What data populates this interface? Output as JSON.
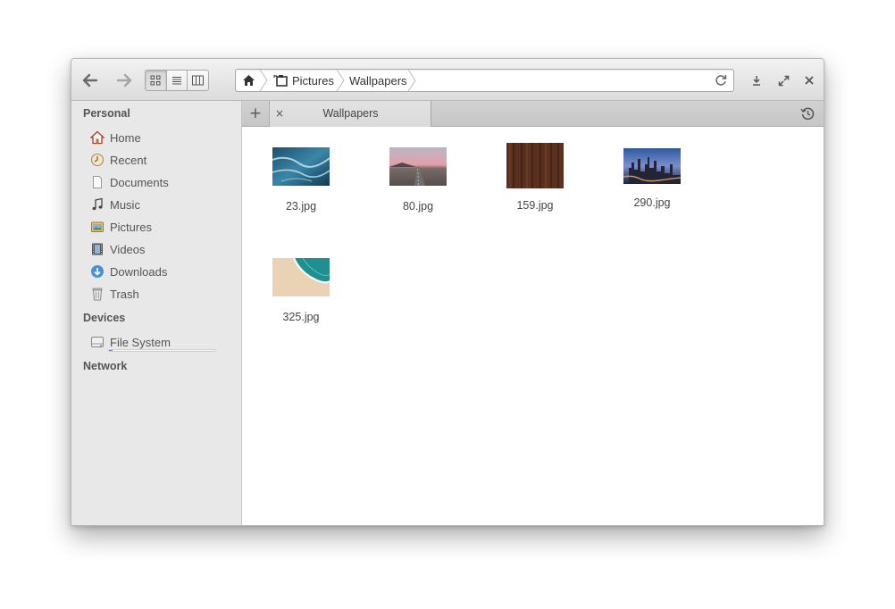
{
  "breadcrumbs": [
    "Pictures",
    "Wallpapers"
  ],
  "sidebar": {
    "sections": [
      "Personal",
      "Devices",
      "Network"
    ],
    "personal": [
      {
        "label": "Home",
        "icon": "home-icon"
      },
      {
        "label": "Recent",
        "icon": "recent-icon"
      },
      {
        "label": "Documents",
        "icon": "documents-icon"
      },
      {
        "label": "Music",
        "icon": "music-icon"
      },
      {
        "label": "Pictures",
        "icon": "pictures-icon"
      },
      {
        "label": "Videos",
        "icon": "videos-icon"
      },
      {
        "label": "Downloads",
        "icon": "downloads-icon"
      },
      {
        "label": "Trash",
        "icon": "trash-icon"
      }
    ],
    "devices": [
      {
        "label": "File System",
        "icon": "drive-icon",
        "usage_fraction": 0.03
      }
    ]
  },
  "tabs": [
    {
      "label": "Wallpapers",
      "close": "×"
    }
  ],
  "tab_add": "+",
  "files": [
    {
      "name": "23.jpg"
    },
    {
      "name": "80.jpg"
    },
    {
      "name": "159.jpg"
    },
    {
      "name": "290.jpg"
    },
    {
      "name": "325.jpg"
    }
  ],
  "colors": {
    "accent": "#4a90d9",
    "home_icon": "#c0392b"
  }
}
